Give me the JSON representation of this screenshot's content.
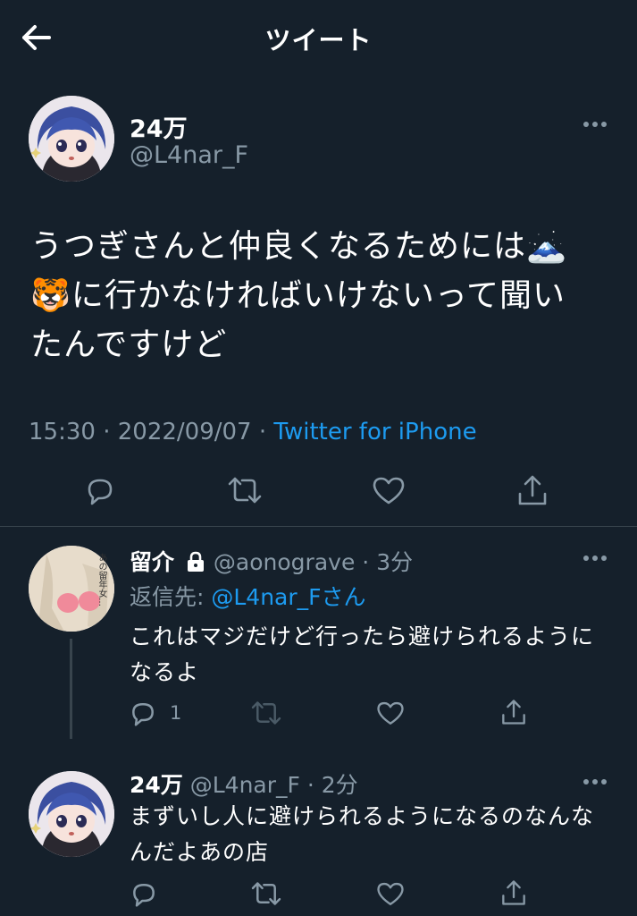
{
  "header": {
    "title": "ツイート",
    "back_icon": "arrow-left-icon"
  },
  "main_tweet": {
    "display_name": "24万",
    "handle": "@L4nar_F",
    "text_line1": "うつぎさんと仲良くなるためには🗻",
    "text_line2": "🐯に行かなければいけないって聞い",
    "text_line3": "たんですけど",
    "time": "15:30",
    "date": "2022/09/07",
    "separator": "·",
    "source": "Twitter for iPhone"
  },
  "reply1": {
    "display_name": "留介",
    "handle": "@aonograve",
    "time_ago": "3分",
    "replying_label": "返信先: ",
    "replying_mention": "@L4nar_F",
    "replying_suffix": "さん",
    "text_line1": "これはマジだけど行ったら避けられるように",
    "text_line2": "なるよ",
    "reply_count": "1",
    "avatar_text": "あの留年女…"
  },
  "reply2": {
    "display_name": "24万",
    "handle": "@L4nar_F",
    "time_ago": "2分",
    "text_line1": "まずいし人に避けられるようになるのなんな",
    "text_line2": "んだよあの店"
  },
  "colors": {
    "background": "#15202b",
    "secondary_text": "#8899a6",
    "link": "#1d9bf0",
    "divider": "#38444d"
  }
}
